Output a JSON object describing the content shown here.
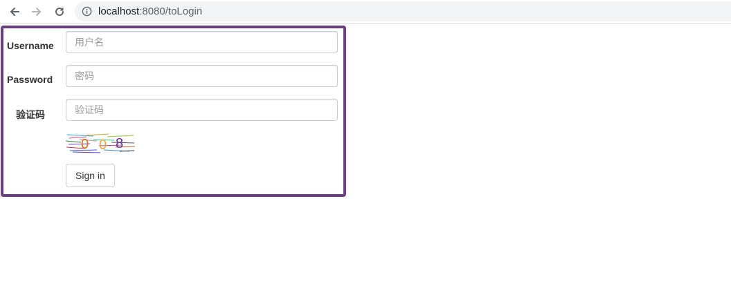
{
  "browser": {
    "url_host": "localhost",
    "url_rest": ":8080/toLogin",
    "icons": [
      "back-arrow-icon",
      "forward-arrow-icon",
      "reload-icon",
      "info-icon"
    ]
  },
  "form": {
    "username_label": "Username",
    "username_placeholder": "用户名",
    "password_label": "Password",
    "password_placeholder": "密码",
    "captcha_label": "验证码",
    "captcha_placeholder": "验证码",
    "captcha_text": "0 0 8",
    "signin_label": "Sign in"
  },
  "colors": {
    "border_accent": "#6b3e80",
    "captcha_digits": [
      "#e0701a",
      "#e8a33a",
      "#6a2fa0"
    ]
  }
}
